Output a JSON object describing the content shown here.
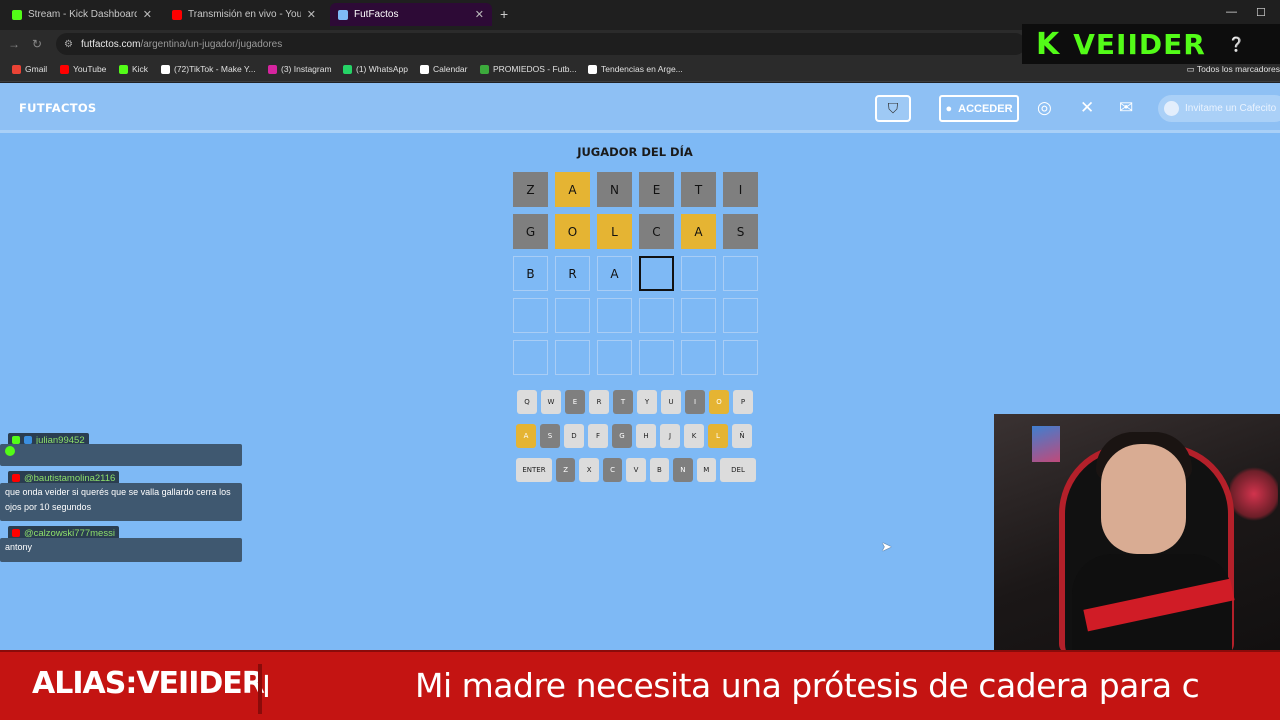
{
  "browser": {
    "tabs": [
      {
        "label": "Stream - Kick Dashboard",
        "color": "#53fc18",
        "active": false
      },
      {
        "label": "Transmisión en vivo - YouTube",
        "color": "#ff0000",
        "active": false
      },
      {
        "label": "FutFactos",
        "color": "#7eb9f5",
        "active": true
      }
    ],
    "new_tab": "+",
    "url_domain": "futfactos.com",
    "url_path": "/argentina/un-jugador/jugadores",
    "bookmarks": [
      {
        "label": "Gmail",
        "color": "#ea4335"
      },
      {
        "label": "YouTube",
        "color": "#ff0000"
      },
      {
        "label": "Kick",
        "color": "#53fc18"
      },
      {
        "label": "(72)TikTok - Make Y...",
        "color": "#ffffff"
      },
      {
        "label": "(3) Instagram",
        "color": "#d6249f"
      },
      {
        "label": "(1) WhatsApp",
        "color": "#25d366"
      },
      {
        "label": "Calendar",
        "color": "#ffffff"
      },
      {
        "label": "PROMIEDOS - Futb...",
        "color": "#3caa3c"
      },
      {
        "label": "Tendencias en Arge...",
        "color": "#ffffff"
      }
    ],
    "all_bookmarks": "Todos los marcadores"
  },
  "overlay_logo": {
    "k": "K",
    "name": "VEIIDER"
  },
  "site": {
    "logo": "FUTFACTOS",
    "acceder": "ACCEDER",
    "cafecito": "Invitame un Cafecito"
  },
  "game": {
    "title": "JUGADOR DEL DÍA",
    "rows": [
      [
        {
          "l": "Z",
          "s": "gray"
        },
        {
          "l": "A",
          "s": "yellow"
        },
        {
          "l": "N",
          "s": "gray"
        },
        {
          "l": "E",
          "s": "gray"
        },
        {
          "l": "T",
          "s": "gray"
        },
        {
          "l": "I",
          "s": "gray"
        }
      ],
      [
        {
          "l": "G",
          "s": "gray"
        },
        {
          "l": "O",
          "s": "yellow"
        },
        {
          "l": "L",
          "s": "yellow"
        },
        {
          "l": "C",
          "s": "gray"
        },
        {
          "l": "A",
          "s": "yellow"
        },
        {
          "l": "S",
          "s": "gray"
        }
      ],
      [
        {
          "l": "B",
          "s": "typed"
        },
        {
          "l": "R",
          "s": "typed"
        },
        {
          "l": "A",
          "s": "typed"
        },
        {
          "l": "",
          "s": "cursor"
        },
        {
          "l": "",
          "s": "empty"
        },
        {
          "l": "",
          "s": "empty"
        }
      ],
      [
        {
          "l": "",
          "s": "empty"
        },
        {
          "l": "",
          "s": "empty"
        },
        {
          "l": "",
          "s": "empty"
        },
        {
          "l": "",
          "s": "empty"
        },
        {
          "l": "",
          "s": "empty"
        },
        {
          "l": "",
          "s": "empty"
        }
      ],
      [
        {
          "l": "",
          "s": "empty"
        },
        {
          "l": "",
          "s": "empty"
        },
        {
          "l": "",
          "s": "empty"
        },
        {
          "l": "",
          "s": "empty"
        },
        {
          "l": "",
          "s": "empty"
        },
        {
          "l": "",
          "s": "empty"
        }
      ]
    ],
    "keyboard": [
      [
        {
          "k": "Q",
          "s": ""
        },
        {
          "k": "W",
          "s": ""
        },
        {
          "k": "E",
          "s": "gray"
        },
        {
          "k": "R",
          "s": ""
        },
        {
          "k": "T",
          "s": "gray"
        },
        {
          "k": "Y",
          "s": ""
        },
        {
          "k": "U",
          "s": ""
        },
        {
          "k": "I",
          "s": "gray"
        },
        {
          "k": "O",
          "s": "yellow"
        },
        {
          "k": "P",
          "s": ""
        }
      ],
      [
        {
          "k": "A",
          "s": "yellow"
        },
        {
          "k": "S",
          "s": "gray"
        },
        {
          "k": "D",
          "s": ""
        },
        {
          "k": "F",
          "s": ""
        },
        {
          "k": "G",
          "s": "gray"
        },
        {
          "k": "H",
          "s": ""
        },
        {
          "k": "J",
          "s": ""
        },
        {
          "k": "K",
          "s": ""
        },
        {
          "k": "L",
          "s": "yellow"
        },
        {
          "k": "Ñ",
          "s": ""
        }
      ],
      [
        {
          "k": "ENTER",
          "s": "wide"
        },
        {
          "k": "Z",
          "s": "gray"
        },
        {
          "k": "X",
          "s": ""
        },
        {
          "k": "C",
          "s": "gray"
        },
        {
          "k": "V",
          "s": ""
        },
        {
          "k": "B",
          "s": ""
        },
        {
          "k": "N",
          "s": "gray"
        },
        {
          "k": "M",
          "s": ""
        },
        {
          "k": "DEL",
          "s": "wide"
        }
      ]
    ]
  },
  "chat": {
    "messages": [
      {
        "user": "julian99452",
        "text": ""
      },
      {
        "user": "@bautistamolina2116",
        "text": "que onda veider si querés que se valla gallardo cerra los ojos por 10 segundos"
      },
      {
        "user": "@calzowski777messi",
        "text": "antony"
      }
    ]
  },
  "ticker": {
    "alias": "ALIAS:VEIIDER",
    "bar": "I",
    "message": "Mi madre necesita una prótesis de cadera para c"
  }
}
